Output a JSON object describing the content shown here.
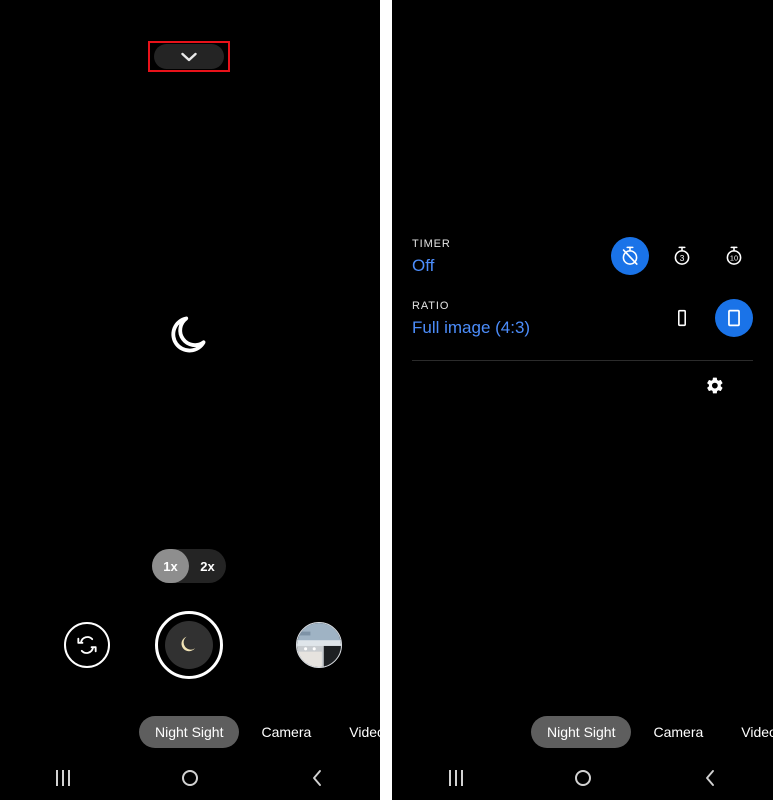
{
  "panels": [
    {
      "id": "left",
      "name": "camera-viewfinder-panel",
      "top_pill": {
        "icon": "chevron-down-icon",
        "highlighted": true
      },
      "center_watermark_icon": "crescent-moon-icon",
      "drawer_visible": false
    },
    {
      "id": "right",
      "name": "camera-settings-drawer-panel",
      "top_pill": {
        "icon": "chevron-down-icon",
        "highlighted": false
      },
      "center_watermark_icon": "",
      "drawer_visible": true
    }
  ],
  "drawer": {
    "timer": {
      "label": "TIMER",
      "value": "Off",
      "options": [
        {
          "icon": "timer-off-icon",
          "label": "Off",
          "selected": true
        },
        {
          "icon": "timer-3s-icon",
          "label": "3",
          "selected": false
        },
        {
          "icon": "timer-10s-icon",
          "label": "10",
          "selected": false
        }
      ]
    },
    "ratio": {
      "label": "RATIO",
      "value": "Full image (4:3)",
      "options": [
        {
          "icon": "ratio-16-9-icon",
          "label": "16:9",
          "selected": false
        },
        {
          "icon": "ratio-4-3-icon",
          "label": "4:3",
          "selected": true
        }
      ]
    },
    "settings": {
      "icon": "gear-icon",
      "label": "Settings"
    }
  },
  "zoom": {
    "options": [
      {
        "label": "1x",
        "active": true
      },
      {
        "label": "2x",
        "active": false
      }
    ]
  },
  "controls": {
    "flip_camera": {
      "icon": "flip-camera-icon",
      "label": "Switch camera"
    },
    "shutter": {
      "icon": "crescent-moon-icon",
      "label": "Capture"
    },
    "gallery_thumbnail": {
      "icon": "photo-thumbnail",
      "label": "Last photo"
    }
  },
  "modes": [
    {
      "label": "Night Sight",
      "active": true
    },
    {
      "label": "Camera",
      "active": false
    },
    {
      "label": "Video",
      "active": false
    }
  ],
  "navbar": [
    {
      "icon": "recents-icon",
      "label": "Recents"
    },
    {
      "icon": "home-icon",
      "label": "Home"
    },
    {
      "icon": "back-icon",
      "label": "Back"
    }
  ],
  "colors": {
    "accent_blue": "#1a73e8",
    "value_text_blue": "#4c8dfb",
    "highlight_red": "#e8121a",
    "panel_bg": "#000000",
    "pill_bg": "#242424",
    "active_mode_bg": "#5e5e5e"
  }
}
